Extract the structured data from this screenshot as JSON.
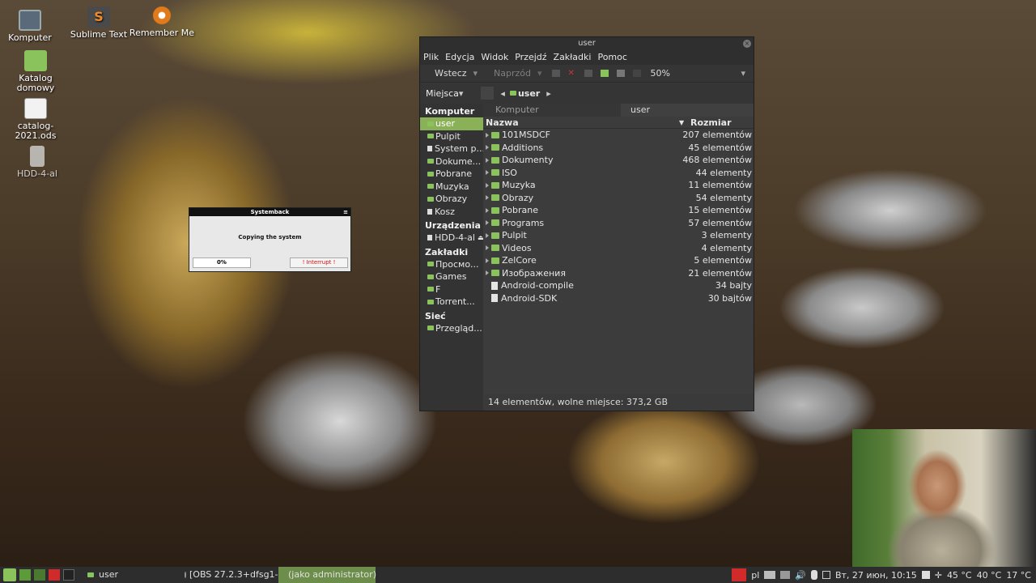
{
  "desktop": {
    "icons": [
      {
        "label": "Komputer"
      },
      {
        "label": "Sublime Text"
      },
      {
        "label": "Remember Me"
      },
      {
        "label": "Katalog domowy"
      },
      {
        "label": "catalog-2021.ods"
      },
      {
        "label": "HDD-4-al"
      }
    ]
  },
  "filemanager": {
    "title": "user",
    "menu": [
      "Plik",
      "Edycja",
      "Widok",
      "Przejdź",
      "Zakładki",
      "Pomoc"
    ],
    "toolbar": {
      "back": "Wstecz",
      "forward": "Naprzód",
      "zoom": "50%"
    },
    "places_label": "Miejsca",
    "path_current": "user",
    "sidebar": {
      "computer_header": "Komputer",
      "computer_items": [
        "user",
        "Pulpit",
        "System p...",
        "Dokume...",
        "Pobrane",
        "Muzyka",
        "Obrazy",
        "Kosz"
      ],
      "devices_header": "Urządzenia",
      "devices_items": [
        "HDD-4-al"
      ],
      "bookmarks_header": "Zakładki",
      "bookmarks_items": [
        "Просмо...",
        "Games",
        "F",
        "Torrent..."
      ],
      "network_header": "Sieć",
      "network_items": [
        "Przegląd..."
      ]
    },
    "tabs": [
      "Komputer",
      "user"
    ],
    "columns": {
      "name": "Nazwa",
      "size": "Rozmiar"
    },
    "rows": [
      {
        "name": "101MSDCF",
        "size": "207 elementów",
        "type": "folder"
      },
      {
        "name": "Additions",
        "size": "45 elementów",
        "type": "folder"
      },
      {
        "name": "Dokumenty",
        "size": "468 elementów",
        "type": "folder"
      },
      {
        "name": "ISO",
        "size": "44 elementy",
        "type": "folder"
      },
      {
        "name": "Muzyka",
        "size": "11 elementów",
        "type": "folder"
      },
      {
        "name": "Obrazy",
        "size": "54 elementy",
        "type": "folder"
      },
      {
        "name": "Pobrane",
        "size": "15 elementów",
        "type": "folder"
      },
      {
        "name": "Programs",
        "size": "57 elementów",
        "type": "folder"
      },
      {
        "name": "Pulpit",
        "size": "3 elementy",
        "type": "folder"
      },
      {
        "name": "Videos",
        "size": "4 elementy",
        "type": "folder"
      },
      {
        "name": "ZelCore",
        "size": "5 elementów",
        "type": "folder"
      },
      {
        "name": "Изображения",
        "size": "21 elementów",
        "type": "folder"
      },
      {
        "name": "Android-compile",
        "size": "34 bajty",
        "type": "file"
      },
      {
        "name": "Android-SDK",
        "size": "30 bajtów",
        "type": "file"
      }
    ],
    "status": "14 elementów, wolne miejsce: 373,2 GB"
  },
  "systemback": {
    "title": "Systemback",
    "message": "Copying the system",
    "progress_text": "0%",
    "progress": 0,
    "interrupt_label": "! Interrupt !"
  },
  "taskbar": {
    "apps": [
      {
        "label": "user"
      },
      {
        "label": "[OBS 27.2.3+dfsg1-..."
      },
      {
        "label": "(jako administrator)"
      }
    ],
    "tray": {
      "lang": "pl",
      "datetime": "Вт, 27 июн, 10:15",
      "temp1": "45 °C",
      "temp2": "40 °C",
      "temp3": "17 °C"
    }
  }
}
